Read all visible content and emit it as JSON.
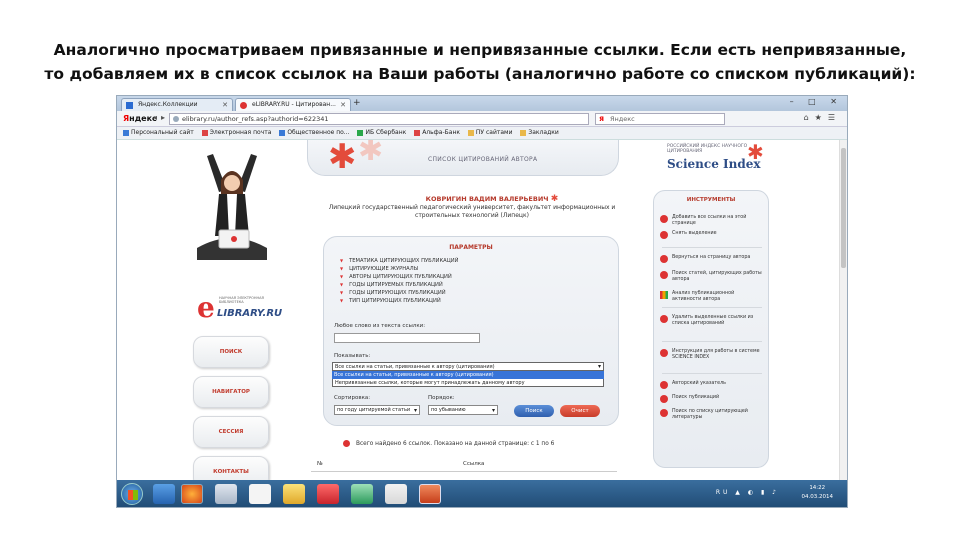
{
  "slide": {
    "line1": "Аналогично просматриваем привязанные и непривязанные ссылки. Если есть непривязанные,",
    "line2": "то добавляем их в список ссылок на Ваши работы (аналогично работе со списком публикаций):"
  },
  "browser": {
    "tabs": [
      {
        "label": "Яндекс.Коллекции"
      },
      {
        "label": "eLIBRARY.RU - Цитирован..."
      }
    ],
    "new_tab": "+",
    "window_buttons": "– □ ✕",
    "yandex_brand_1": "Я",
    "yandex_brand_2": "ндекс",
    "url": "elibrary.ru/author_refs.asp?authorid=622341",
    "search_placeholder": "Яндекс",
    "bookmarks": [
      "Персональный сайт",
      "Электронная почта",
      "Общественное по...",
      "ИБ Сбербанк",
      "Альфа-Банк",
      "ПУ сайтами",
      "Закладки"
    ]
  },
  "page": {
    "header_title": "СПИСОК ЦИТИРОВАНИЙ АВТОРА",
    "science_index_small": "РОССИЙСКИЙ ИНДЕКС НАУЧНОГО ЦИТИРОВАНИЯ",
    "science_index": "Science Index",
    "elibrary_tagline": "НАУЧНАЯ ЭЛЕКТРОННАЯ БИБЛИОТЕКА",
    "elibrary_name": "LIBRARY.RU",
    "elibrary_e": "e",
    "author_name": "КОВРИГИН ВАДИМ ВАЛЕРЬЕВИЧ",
    "author_aff": "Липецкий государственный педагогический университет, факультет информационных и строительных технологий (Липецк)",
    "side_buttons": [
      "ПОИСК",
      "НАВИГАТОР",
      "СЕССИЯ",
      "КОНТАКТЫ"
    ],
    "params_title": "ПАРАМЕТРЫ",
    "params_list": [
      "ТЕМАТИКА ЦИТИРУЮЩИХ ПУБЛИКАЦИЙ",
      "ЦИТИРУЮЩИЕ ЖУРНАЛЫ",
      "АВТОРЫ ЦИТИРУЮЩИХ ПУБЛИКАЦИЙ",
      "ГОДЫ ЦИТИРУЕМЫХ ПУБЛИКАЦИЙ",
      "ГОДЫ ЦИТИРУЮЩИХ ПУБЛИКАЦИЙ",
      "ТИП ЦИТИРУЮЩИХ ПУБЛИКАЦИЙ"
    ],
    "search_label": "Любое слово из текста ссылки:",
    "show_label": "Показывать:",
    "show_value": "Все ссылки на статьи, привязанные к автору (цитирования)",
    "show_option_selected": "Все ссылки на статьи, привязанные к автору (цитирования)",
    "show_option_other": "Непривязанные ссылки, которые могут принадлежать данному автору",
    "sort_label": "Сортировка:",
    "sort_value": "по году цитируемой статьи",
    "order_label": "Порядок:",
    "order_value": "по убыванию",
    "search_button": "Поиск",
    "clear_button": "Очист",
    "found_text": "Всего найдено 6 ссылок. Показано на данной странице: с 1 по 6",
    "col_num": "№",
    "col_link": "Ссылка",
    "tools_title": "ИНСТРУМЕНТЫ",
    "tools": [
      "Добавить все ссылки на этой странице",
      "Снять выделение",
      "Вернуться на страницу автора",
      "Поиск статей, цитирующих работы автора",
      "Анализ публикационной активности автора",
      "Удалить выделенные ссылки из списка цитирований",
      "Инструкция для работы в системе SCIENCE INDEX",
      "Авторский указатель",
      "Поиск публикаций",
      "Поиск по списку цитирующей литературы"
    ]
  },
  "taskbar": {
    "lang": "RU",
    "time": "14:22",
    "date": "04.03.2014"
  }
}
